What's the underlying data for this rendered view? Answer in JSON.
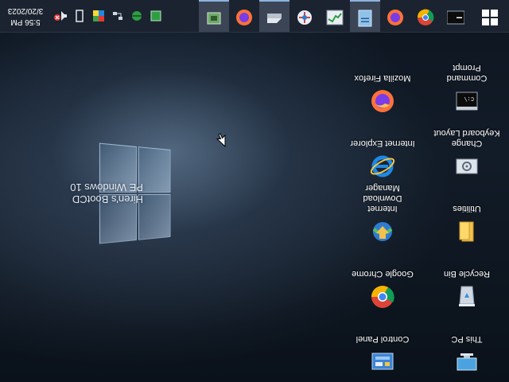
{
  "desktop": {
    "icons": [
      {
        "label": "This PC"
      },
      {
        "label": "Control Panel"
      },
      {
        "label": "Recycle Bin"
      },
      {
        "label": "Google Chrome"
      },
      {
        "label": "Utilities"
      },
      {
        "label": "Internet Download Manager"
      },
      {
        "label": "Change Keyboard Layout"
      },
      {
        "label": "Internet Explorer"
      },
      {
        "label": "Command Prompt"
      },
      {
        "label": "Mozilla Firefox"
      }
    ],
    "branding": {
      "line1": "Hiren's BootCD",
      "line2": "PE Windows 10"
    }
  },
  "taskbar": {
    "apps": [
      {
        "icon": "command-prompt-icon"
      },
      {
        "icon": "chrome-icon"
      },
      {
        "icon": "firefox-icon"
      },
      {
        "icon": "notepad-icon"
      },
      {
        "icon": "task-manager-icon"
      },
      {
        "icon": "network-icon"
      },
      {
        "icon": "drive-icon"
      },
      {
        "icon": "firefox-icon"
      },
      {
        "icon": "hardware-icon"
      }
    ],
    "tray": {
      "icons": [
        "chip-icon",
        "network-share-icon",
        "ethernet-icon",
        "color-app-icon",
        "usb-icon",
        "volume-muted-icon"
      ],
      "time": "5:56 PM",
      "date": "3/20/2023"
    }
  },
  "colors": {
    "taskbar": "#1b2330",
    "accent": "#8fb4e0"
  }
}
